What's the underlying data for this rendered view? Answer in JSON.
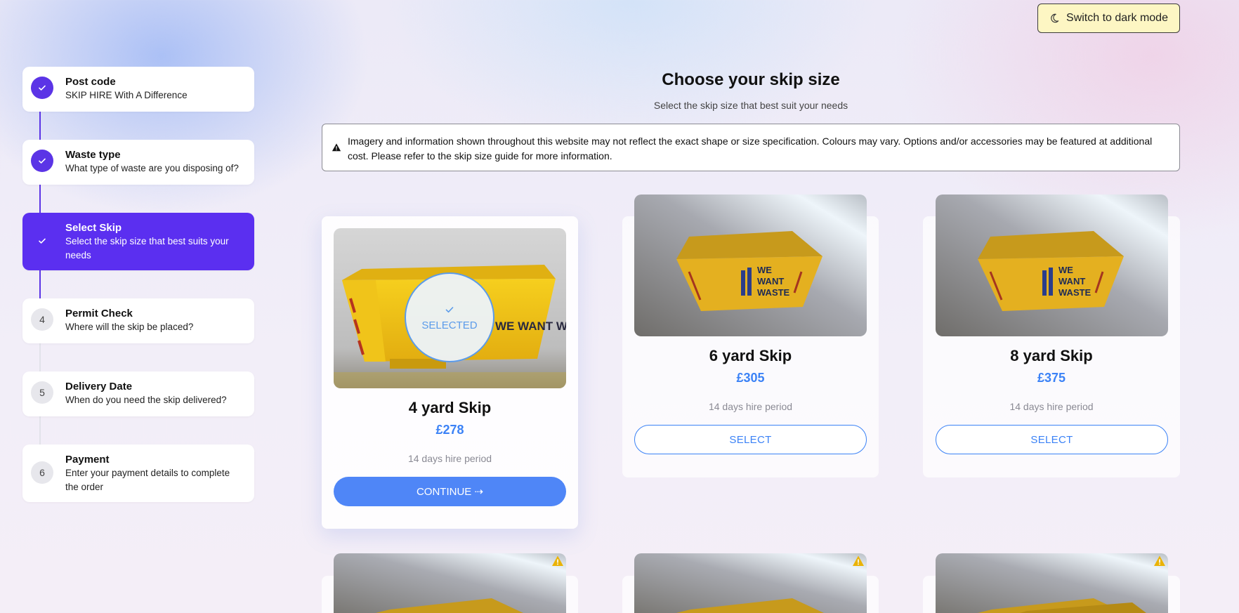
{
  "theme_toggle": {
    "label": "Switch to dark mode"
  },
  "steps": [
    {
      "number": "1",
      "title": "Post code",
      "desc": "SKIP HIRE With A Difference",
      "state": "done"
    },
    {
      "number": "2",
      "title": "Waste type",
      "desc": "What type of waste are you disposing of?",
      "state": "done"
    },
    {
      "number": "3",
      "title": "Select Skip",
      "desc": "Select the skip size that best suits your needs",
      "state": "active"
    },
    {
      "number": "4",
      "title": "Permit Check",
      "desc": "Where will the skip be placed?",
      "state": "todo"
    },
    {
      "number": "5",
      "title": "Delivery Date",
      "desc": "When do you need the skip delivered?",
      "state": "todo"
    },
    {
      "number": "6",
      "title": "Payment",
      "desc": "Enter your payment details to complete the order",
      "state": "todo"
    }
  ],
  "page": {
    "title": "Choose your skip size",
    "subtitle": "Select the skip size that best suit your needs",
    "notice": "Imagery and information shown throughout this website may not reflect the exact shape or size specification. Colours may vary. Options and/or accessories may be featured at additional cost. Please refer to the skip size guide for more information."
  },
  "skips": [
    {
      "name": "4 yard Skip",
      "price": "£278",
      "hire": "14 days hire period",
      "selected": true,
      "button": "CONTINUE ⇢",
      "badge": "SELECTED"
    },
    {
      "name": "6 yard Skip",
      "price": "£305",
      "hire": "14 days hire period",
      "selected": false,
      "button": "SELECT"
    },
    {
      "name": "8 yard Skip",
      "price": "£375",
      "hire": "14 days hire period",
      "selected": false,
      "button": "SELECT"
    }
  ],
  "skip_image_text": "WE WANT WASTE",
  "colors": {
    "accent": "#5b2ff0",
    "price": "#3b82f6",
    "button": "#4f86f7",
    "skip_yellow": "#e8b91f"
  }
}
